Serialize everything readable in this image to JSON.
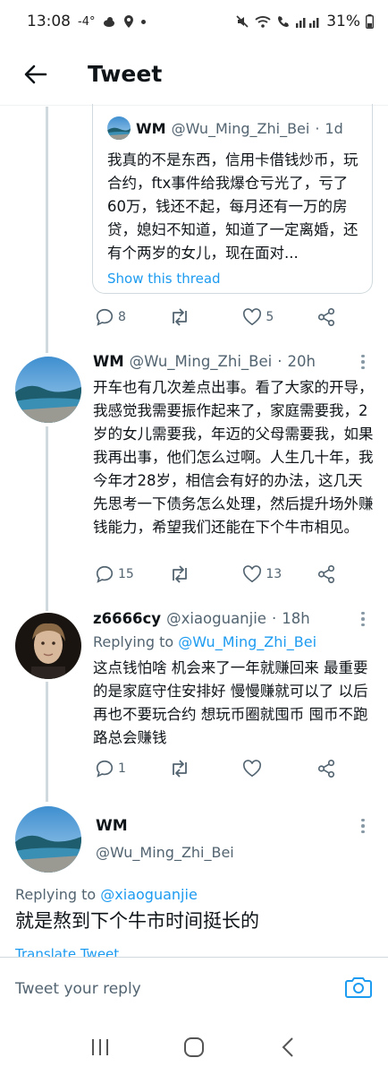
{
  "status_bar": {
    "time": "13:08",
    "temperature": "-4°",
    "battery": "31%"
  },
  "header": {
    "title": "Tweet"
  },
  "quoted_tweet": {
    "name": "WM",
    "handle": "@Wu_Ming_Zhi_Bei",
    "separator": "·",
    "time": "1d",
    "text": "我真的不是东西，信用卡借钱炒币，玩合约，ftx事件给我爆仓亏光了，亏了60万，钱还不起，每月还有一万的房贷，媳妇不知道，知道了一定离婚，还有个两岁的女儿，现在面对...",
    "show_thread": "Show this thread",
    "reply_count": "8",
    "like_count": "5"
  },
  "tweets": [
    {
      "name": "WM",
      "handle": "@Wu_Ming_Zhi_Bei",
      "separator": "·",
      "time": "20h",
      "text": "开车也有几次差点出事。看了大家的开导，我感觉我需要振作起来了，家庭需要我，2岁的女儿需要我，年迈的父母需要我，如果我再出事，他们怎么过啊。人生几十年，我今年才28岁，相信会有好的办法，这几天先思考一下债务怎么处理，然后提升场外赚钱能力，希望我们还能在下个牛市相见。",
      "reply_count": "15",
      "like_count": "13"
    },
    {
      "name": "z6666cy",
      "handle": "@xiaoguanjie",
      "separator": "·",
      "time": "18h",
      "replying_prefix": "Replying to",
      "replying_to": "@Wu_Ming_Zhi_Bei",
      "text": "这点钱怕啥 机会来了一年就赚回来 最重要的是家庭守住安排好  慢慢赚就可以了 以后再也不要玩合约  想玩币圈就囤币 囤币不跑路总会赚钱",
      "reply_count": "1"
    }
  ],
  "focused_tweet": {
    "name": "WM",
    "handle": "@Wu_Ming_Zhi_Bei",
    "replying_prefix": "Replying to",
    "replying_to": "@xiaoguanjie",
    "text": "就是熬到下个牛市时间挺长的",
    "translate": "Translate Tweet"
  },
  "reply_bar": {
    "placeholder": "Tweet your reply"
  },
  "colors": {
    "accent": "#1d9bf0",
    "text": "#0f1419",
    "secondary_text": "#536471",
    "border": "#cfd9de"
  },
  "icons": [
    "back-arrow-icon",
    "reply-icon",
    "retweet-icon",
    "like-icon",
    "share-icon",
    "more-icon",
    "camera-icon",
    "recents-icon",
    "home-icon",
    "back-nav-icon"
  ]
}
